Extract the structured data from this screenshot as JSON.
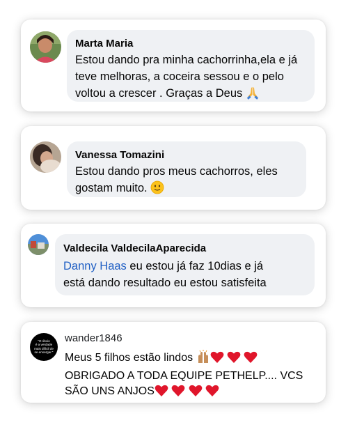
{
  "comments": [
    {
      "author": "Marta Maria",
      "lines": [
        "Estou dando pra minha cachorrinha,ela e já",
        "teve melhoras, a coceira sessou e o pelo",
        "voltou a crescer . Graças a Deus"
      ],
      "emoji": "praying-hands"
    },
    {
      "author": "Vanessa Tomazini",
      "lines": [
        "Estou dando pros meus cachorros, eles",
        "gostam muito."
      ],
      "emoji": "slightly-smiling-face"
    },
    {
      "author": "Valdecila ValdecilaAparecida",
      "mention": "Danny Haas",
      "lines": [
        " eu estou já faz 10dias e já",
        "está dando resultado eu estou satisfeita"
      ]
    },
    {
      "author": "wander1846",
      "avatar_text": [
        "\"O óbvio",
        "é a verdade",
        "mais difícil de",
        "se enxergar.\""
      ],
      "lines": [
        "Meus 5 filhos estão lindos",
        "OBRIGADO A TODA EQUIPE PETHELP.... VCS",
        "SÃO UNS ANJOS"
      ],
      "emojis": [
        "raised-hands",
        "red-heart"
      ]
    }
  ],
  "colors": {
    "bubble": "#eff1f4",
    "mention": "#1f5fc4",
    "heart": "#e0162b"
  }
}
